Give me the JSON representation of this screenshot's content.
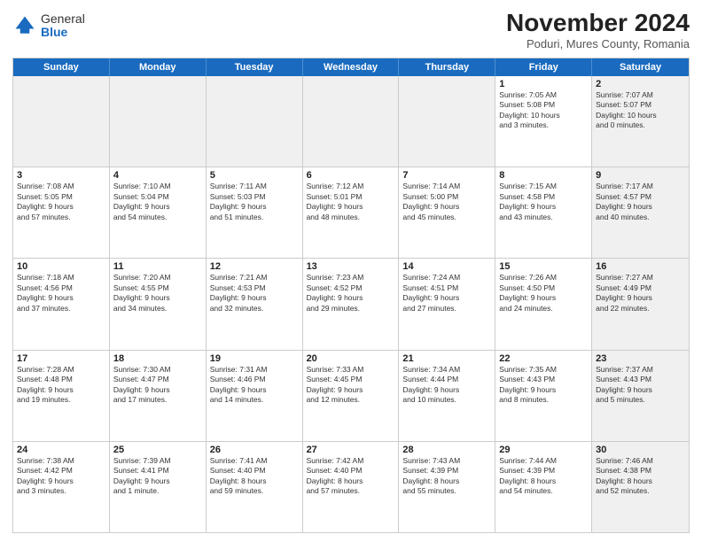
{
  "logo": {
    "general": "General",
    "blue": "Blue"
  },
  "title": "November 2024",
  "location": "Poduri, Mures County, Romania",
  "days_header": [
    "Sunday",
    "Monday",
    "Tuesday",
    "Wednesday",
    "Thursday",
    "Friday",
    "Saturday"
  ],
  "weeks": [
    [
      {
        "day": "",
        "info": "",
        "shaded": true
      },
      {
        "day": "",
        "info": "",
        "shaded": true
      },
      {
        "day": "",
        "info": "",
        "shaded": true
      },
      {
        "day": "",
        "info": "",
        "shaded": true
      },
      {
        "day": "",
        "info": "",
        "shaded": true
      },
      {
        "day": "1",
        "info": "Sunrise: 7:05 AM\nSunset: 5:08 PM\nDaylight: 10 hours\nand 3 minutes.",
        "shaded": false
      },
      {
        "day": "2",
        "info": "Sunrise: 7:07 AM\nSunset: 5:07 PM\nDaylight: 10 hours\nand 0 minutes.",
        "shaded": true
      }
    ],
    [
      {
        "day": "3",
        "info": "Sunrise: 7:08 AM\nSunset: 5:05 PM\nDaylight: 9 hours\nand 57 minutes.",
        "shaded": false
      },
      {
        "day": "4",
        "info": "Sunrise: 7:10 AM\nSunset: 5:04 PM\nDaylight: 9 hours\nand 54 minutes.",
        "shaded": false
      },
      {
        "day": "5",
        "info": "Sunrise: 7:11 AM\nSunset: 5:03 PM\nDaylight: 9 hours\nand 51 minutes.",
        "shaded": false
      },
      {
        "day": "6",
        "info": "Sunrise: 7:12 AM\nSunset: 5:01 PM\nDaylight: 9 hours\nand 48 minutes.",
        "shaded": false
      },
      {
        "day": "7",
        "info": "Sunrise: 7:14 AM\nSunset: 5:00 PM\nDaylight: 9 hours\nand 45 minutes.",
        "shaded": false
      },
      {
        "day": "8",
        "info": "Sunrise: 7:15 AM\nSunset: 4:58 PM\nDaylight: 9 hours\nand 43 minutes.",
        "shaded": false
      },
      {
        "day": "9",
        "info": "Sunrise: 7:17 AM\nSunset: 4:57 PM\nDaylight: 9 hours\nand 40 minutes.",
        "shaded": true
      }
    ],
    [
      {
        "day": "10",
        "info": "Sunrise: 7:18 AM\nSunset: 4:56 PM\nDaylight: 9 hours\nand 37 minutes.",
        "shaded": false
      },
      {
        "day": "11",
        "info": "Sunrise: 7:20 AM\nSunset: 4:55 PM\nDaylight: 9 hours\nand 34 minutes.",
        "shaded": false
      },
      {
        "day": "12",
        "info": "Sunrise: 7:21 AM\nSunset: 4:53 PM\nDaylight: 9 hours\nand 32 minutes.",
        "shaded": false
      },
      {
        "day": "13",
        "info": "Sunrise: 7:23 AM\nSunset: 4:52 PM\nDaylight: 9 hours\nand 29 minutes.",
        "shaded": false
      },
      {
        "day": "14",
        "info": "Sunrise: 7:24 AM\nSunset: 4:51 PM\nDaylight: 9 hours\nand 27 minutes.",
        "shaded": false
      },
      {
        "day": "15",
        "info": "Sunrise: 7:26 AM\nSunset: 4:50 PM\nDaylight: 9 hours\nand 24 minutes.",
        "shaded": false
      },
      {
        "day": "16",
        "info": "Sunrise: 7:27 AM\nSunset: 4:49 PM\nDaylight: 9 hours\nand 22 minutes.",
        "shaded": true
      }
    ],
    [
      {
        "day": "17",
        "info": "Sunrise: 7:28 AM\nSunset: 4:48 PM\nDaylight: 9 hours\nand 19 minutes.",
        "shaded": false
      },
      {
        "day": "18",
        "info": "Sunrise: 7:30 AM\nSunset: 4:47 PM\nDaylight: 9 hours\nand 17 minutes.",
        "shaded": false
      },
      {
        "day": "19",
        "info": "Sunrise: 7:31 AM\nSunset: 4:46 PM\nDaylight: 9 hours\nand 14 minutes.",
        "shaded": false
      },
      {
        "day": "20",
        "info": "Sunrise: 7:33 AM\nSunset: 4:45 PM\nDaylight: 9 hours\nand 12 minutes.",
        "shaded": false
      },
      {
        "day": "21",
        "info": "Sunrise: 7:34 AM\nSunset: 4:44 PM\nDaylight: 9 hours\nand 10 minutes.",
        "shaded": false
      },
      {
        "day": "22",
        "info": "Sunrise: 7:35 AM\nSunset: 4:43 PM\nDaylight: 9 hours\nand 8 minutes.",
        "shaded": false
      },
      {
        "day": "23",
        "info": "Sunrise: 7:37 AM\nSunset: 4:43 PM\nDaylight: 9 hours\nand 5 minutes.",
        "shaded": true
      }
    ],
    [
      {
        "day": "24",
        "info": "Sunrise: 7:38 AM\nSunset: 4:42 PM\nDaylight: 9 hours\nand 3 minutes.",
        "shaded": false
      },
      {
        "day": "25",
        "info": "Sunrise: 7:39 AM\nSunset: 4:41 PM\nDaylight: 9 hours\nand 1 minute.",
        "shaded": false
      },
      {
        "day": "26",
        "info": "Sunrise: 7:41 AM\nSunset: 4:40 PM\nDaylight: 8 hours\nand 59 minutes.",
        "shaded": false
      },
      {
        "day": "27",
        "info": "Sunrise: 7:42 AM\nSunset: 4:40 PM\nDaylight: 8 hours\nand 57 minutes.",
        "shaded": false
      },
      {
        "day": "28",
        "info": "Sunrise: 7:43 AM\nSunset: 4:39 PM\nDaylight: 8 hours\nand 55 minutes.",
        "shaded": false
      },
      {
        "day": "29",
        "info": "Sunrise: 7:44 AM\nSunset: 4:39 PM\nDaylight: 8 hours\nand 54 minutes.",
        "shaded": false
      },
      {
        "day": "30",
        "info": "Sunrise: 7:46 AM\nSunset: 4:38 PM\nDaylight: 8 hours\nand 52 minutes.",
        "shaded": true
      }
    ]
  ]
}
